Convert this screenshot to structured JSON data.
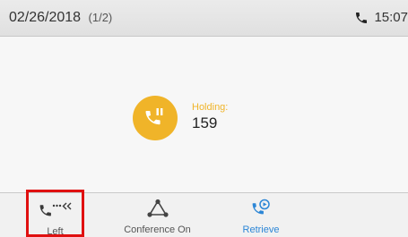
{
  "header": {
    "date": "02/26/2018",
    "page": "(1/2)",
    "time": "15:07"
  },
  "call": {
    "status_label": "Holding:",
    "number": "159"
  },
  "softkeys": [
    {
      "label": "Left",
      "icon": "call-transfer-left-icon",
      "selected": true
    },
    {
      "label": "Conference On",
      "icon": "conference-triangle-icon"
    },
    {
      "label": "Retrieve",
      "icon": "retrieve-call-icon"
    }
  ],
  "colors": {
    "accent_hold": "#f0b429",
    "retrieve_blue": "#2c86d6",
    "selection_red": "#e01010"
  }
}
